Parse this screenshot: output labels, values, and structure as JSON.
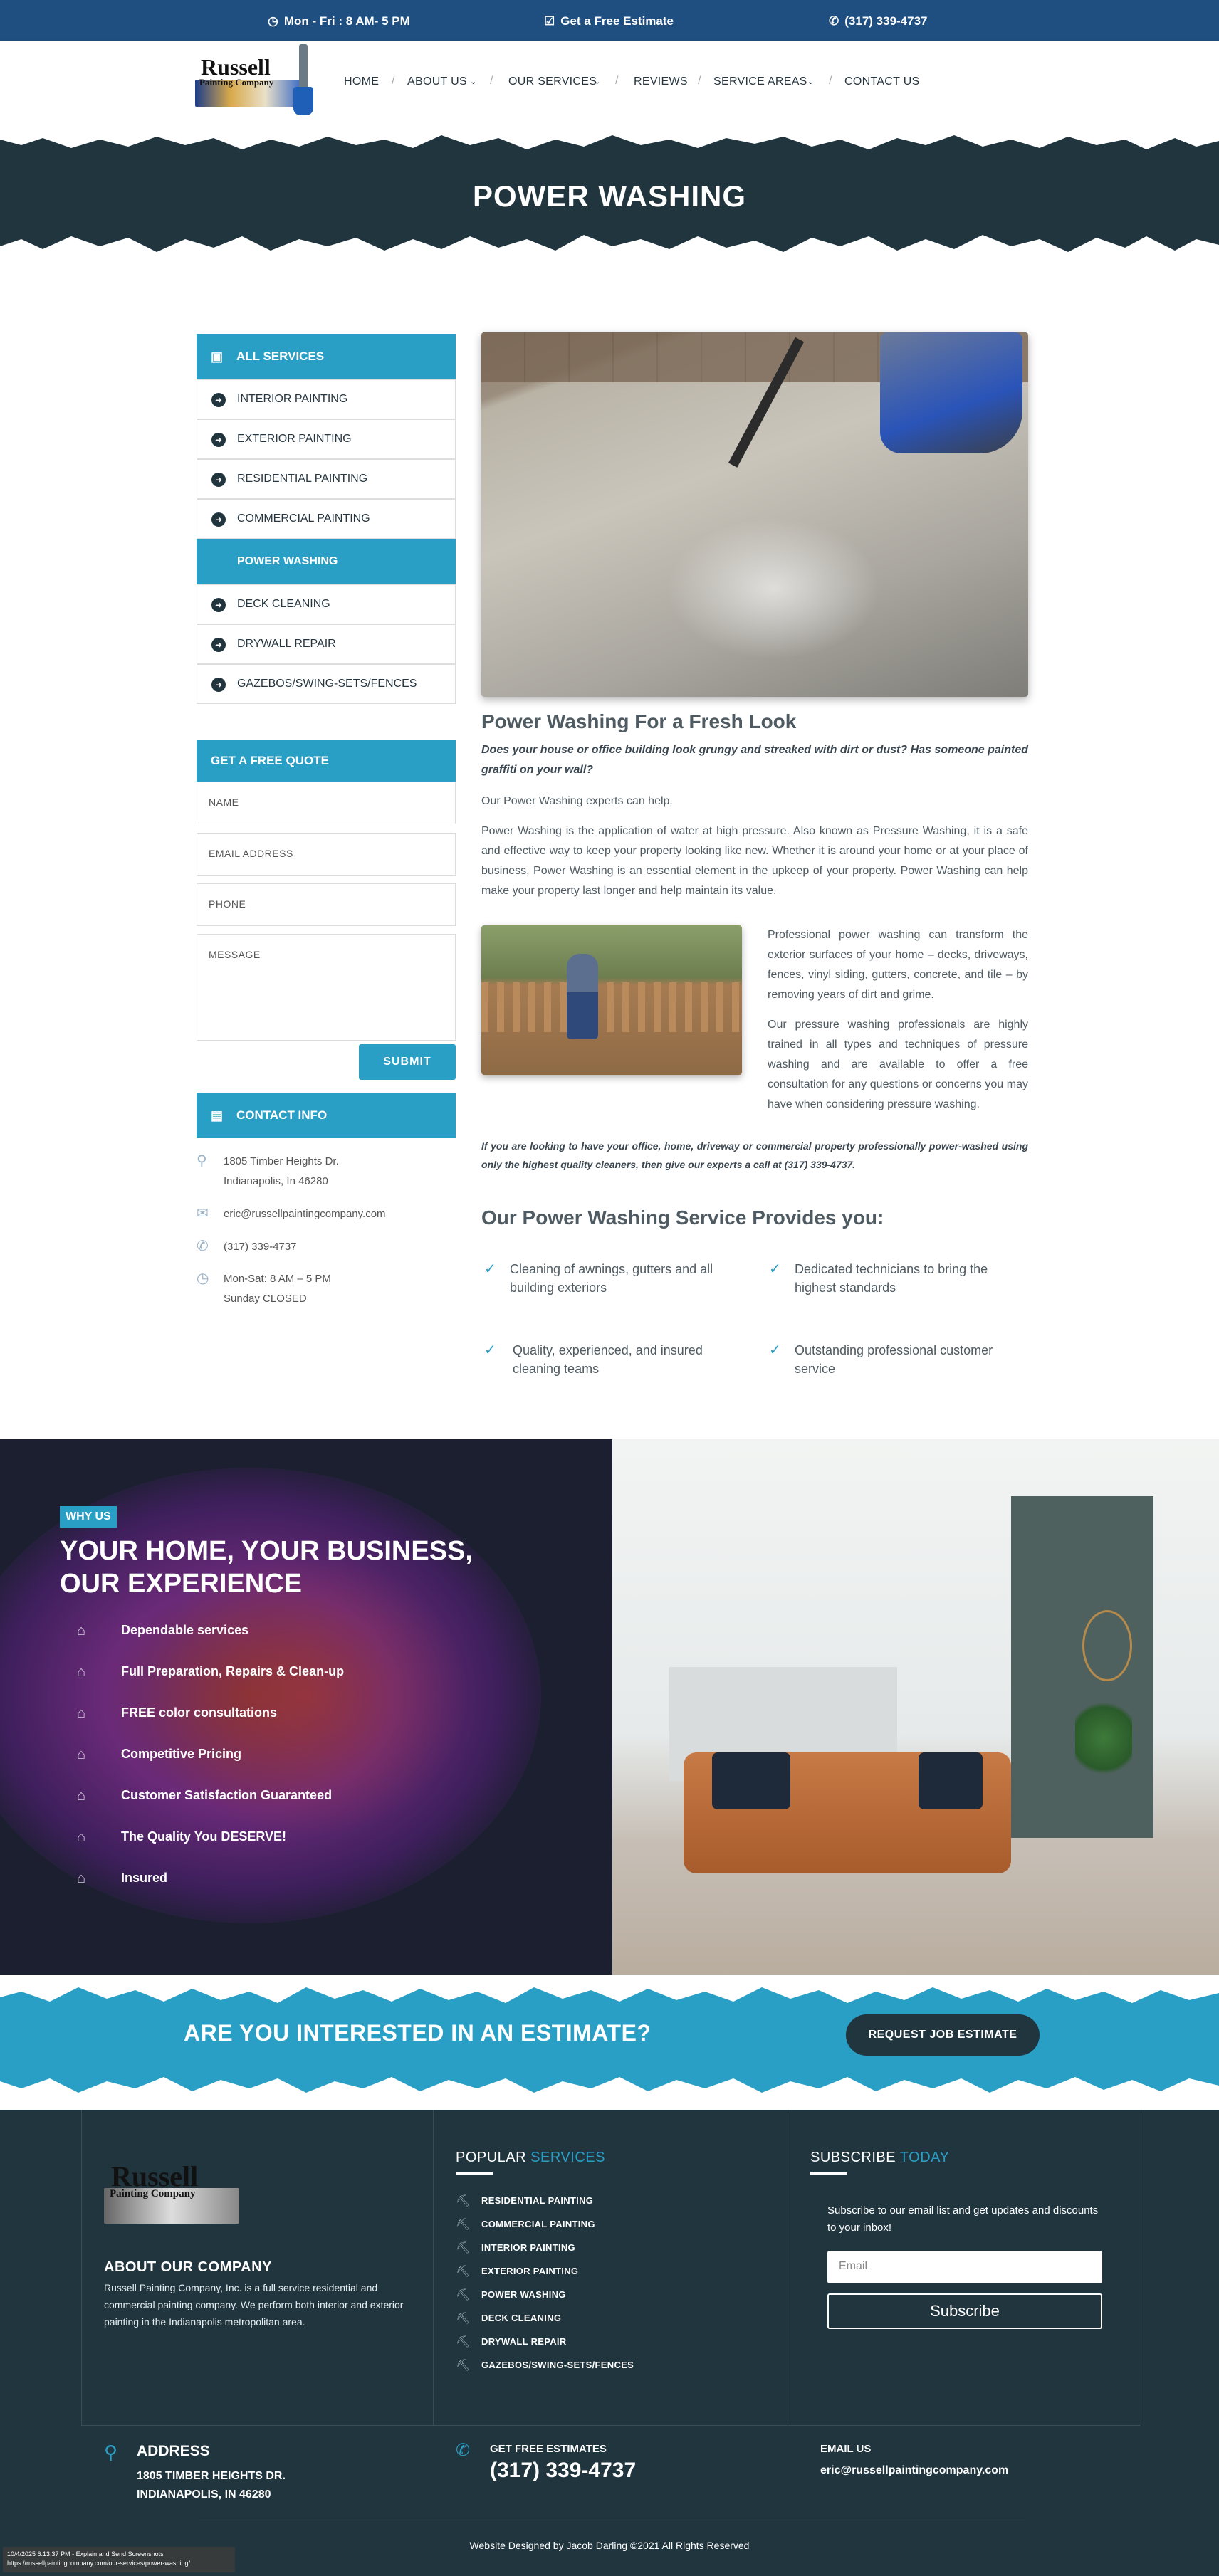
{
  "topbar": {
    "hours": "Mon - Fri : 8 AM- 5 PM",
    "estimate": "Get a Free Estimate",
    "phone": "(317) 339-4737"
  },
  "logo": {
    "line1": "Russell",
    "line2": "Painting Company"
  },
  "nav": {
    "home": "HOME",
    "about": "ABOUT US",
    "services": "OUR SERVICES",
    "reviews": "REVIEWS",
    "areas": "SERVICE AREAS",
    "contact": "CONTACT US"
  },
  "hero": {
    "title": "POWER WASHING"
  },
  "sidebar": {
    "all_services": "ALL SERVICES",
    "items": [
      "INTERIOR PAINTING",
      "EXTERIOR PAINTING",
      "RESIDENTIAL PAINTING",
      "COMMERCIAL PAINTING",
      "POWER WASHING",
      "DECK CLEANING",
      "DRYWALL REPAIR",
      "GAZEBOS/SWING-SETS/FENCES"
    ],
    "quote_title": "GET A FREE QUOTE",
    "name_placeholder": "NAME",
    "email_placeholder": "EMAIL ADDRESS",
    "phone_placeholder": "PHONE",
    "message_placeholder": "MESSAGE",
    "submit": "SUBMIT",
    "contact_title": "CONTACT INFO",
    "address1": "1805 Timber Heights Dr.",
    "address2": "Indianapolis, In 46280",
    "email": "eric@russellpaintingcompany.com",
    "phone": "(317) 339-4737",
    "hours1": "Mon-Sat: 8 AM – 5 PM",
    "hours2": "Sunday CLOSED"
  },
  "content": {
    "title": "Power Washing For a Fresh Look",
    "intro": "Does your house or office building look grungy and streaked with dirt or dust? Has someone painted graffiti on your wall?",
    "p1": "Our Power Washing experts can help.",
    "p2": "Power Washing is the application of water at high pressure. Also known as Pressure Washing, it is a safe and effective way to keep your property looking like new. Whether it is around your home or at your place of business, Power Washing is an essential element in the upkeep of your property. Power Washing can help make your property last longer and help maintain its value.",
    "p3": "Professional power washing can transform the exterior surfaces of your home – decks, driveways, fences, vinyl siding, gutters, concrete, and tile – by removing years of dirt and grime.",
    "p4": "Our pressure washing professionals are highly trained in all types and techniques of pressure washing and are available to offer a free consultation for any questions or concerns you may have when considering pressure washing.",
    "cta_text": "If you are looking to have your office, home, driveway or commercial property professionally power-washed using only the highest quality cleaners, then give our experts a call at (317) 339-4737.",
    "provides_title": "Our Power Washing Service Provides you:",
    "checks": [
      "Cleaning of awnings, gutters and all building exteriors",
      "Dedicated technicians to bring the highest standards",
      "Quality, experienced, and insured cleaning teams",
      "Outstanding professional customer service"
    ]
  },
  "why": {
    "badge": "WHY US",
    "title1": "YOUR HOME, YOUR BUSINESS,",
    "title2": "OUR EXPERIENCE",
    "items": [
      "Dependable services",
      "Full Preparation, Repairs & Clean-up",
      "FREE color consultations",
      "Competitive Pricing",
      "Customer Satisfaction Guaranteed",
      "The Quality You DESERVE!",
      "Insured"
    ]
  },
  "cta": {
    "text": "ARE YOU INTERESTED IN AN ESTIMATE?",
    "button": "REQUEST JOB ESTIMATE"
  },
  "footer": {
    "about_title": "ABOUT OUR COMPANY",
    "about_text": "Russell Painting Company, Inc. is a full service residential and commercial painting company. We perform both interior and exterior painting in the Indianapolis metropolitan area.",
    "popular_a": "POPULAR",
    "popular_b": "SERVICES",
    "links": [
      "RESIDENTIAL PAINTING",
      "COMMERCIAL PAINTING",
      "INTERIOR PAINTING",
      "EXTERIOR PAINTING",
      "POWER WASHING",
      "DECK CLEANING",
      "DRYWALL REPAIR",
      "GAZEBOS/SWING-SETS/FENCES"
    ],
    "subscribe_a": "SUBSCRIBE",
    "subscribe_b": "TODAY",
    "subscribe_text": "Subscribe to our email list and get updates and discounts to your inbox!",
    "email_placeholder": "Email",
    "subscribe_button": "Subscribe",
    "address_title": "ADDRESS",
    "address1": "1805 TIMBER HEIGHTS DR.",
    "address2": "INDIANAPOLIS, IN 46280",
    "estimates_title": "GET FREE ESTIMATES",
    "estimates_phone": "(317) 339-4737",
    "email_title": "EMAIL US",
    "email": "eric@russellpaintingcompany.com",
    "copyright": "Website Designed by Jacob Darling ©2021 All Rights Reserved"
  },
  "status_overlay": {
    "line1": "10/4/2025 6:13:37 PM - Explain and Send Screenshots",
    "line2": "https://russellpaintingcompany.com/our-services/power-washing/"
  },
  "colors": {
    "accent": "#2a9fc6",
    "dark": "#21353f",
    "topbar": "#1e4f80"
  }
}
